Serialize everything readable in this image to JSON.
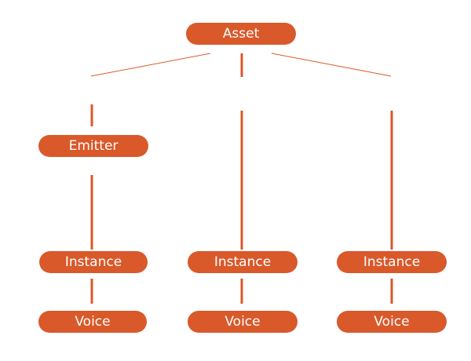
{
  "colors": {
    "node_fill": "#d9592a",
    "node_text": "#ffffff",
    "connector": "#d9592a",
    "background": "#ffffff"
  },
  "nodes": {
    "asset": "Asset",
    "emitter": "Emitter",
    "instance_1": "Instance",
    "instance_2": "Instance",
    "instance_3": "Instance",
    "voice_1": "Voice",
    "voice_2": "Voice",
    "voice_3": "Voice"
  },
  "edges": [
    {
      "from": "asset",
      "to": "emitter"
    },
    {
      "from": "asset",
      "to": "instance_2"
    },
    {
      "from": "asset",
      "to": "instance_3"
    },
    {
      "from": "emitter",
      "to": "instance_1"
    },
    {
      "from": "instance_1",
      "to": "voice_1"
    },
    {
      "from": "instance_2",
      "to": "voice_2"
    },
    {
      "from": "instance_3",
      "to": "voice_3"
    }
  ]
}
